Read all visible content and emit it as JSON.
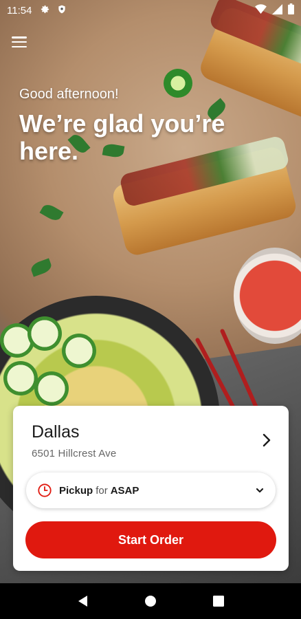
{
  "status_bar": {
    "time": "11:54",
    "left_icons": [
      "gear-icon",
      "shield-icon"
    ],
    "right_icons": [
      "wifi-icon",
      "signal-icon",
      "battery-icon"
    ]
  },
  "hero": {
    "greeting": "Good afternoon!",
    "headline": "We’re glad you’re here."
  },
  "location": {
    "name": "Dallas",
    "address": "6501 Hillcrest Ave"
  },
  "pickup": {
    "mode": "Pickup",
    "for_word": "for",
    "time": "ASAP"
  },
  "actions": {
    "start_order": "Start Order"
  },
  "colors": {
    "accent": "#e0190f",
    "pickup_icon": "#e0190f"
  },
  "nav": [
    "back-icon",
    "home-icon",
    "recents-icon"
  ]
}
